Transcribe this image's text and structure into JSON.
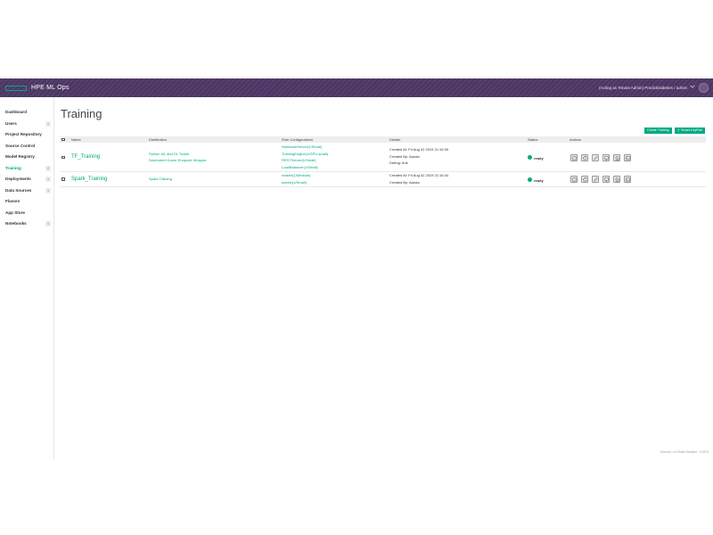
{
  "header": {
    "brand": "HPE ML Ops",
    "acting_as": "(Acting as Tenant Admin) PredictDiabetes / admin"
  },
  "sidebar": {
    "items": [
      {
        "label": "Dashboard",
        "badge": ""
      },
      {
        "label": "Users",
        "badge": "1"
      },
      {
        "label": "Project Repository",
        "badge": ""
      },
      {
        "label": "Source Control",
        "badge": ""
      },
      {
        "label": "Model Registry",
        "badge": ""
      },
      {
        "label": "Training",
        "badge": "2",
        "active": true
      },
      {
        "label": "Deployments",
        "badge": "1"
      },
      {
        "label": "Data Sources",
        "badge": "1"
      },
      {
        "label": "Flavors",
        "badge": ""
      },
      {
        "label": "App Store",
        "badge": ""
      },
      {
        "label": "Notebooks",
        "badge": "1"
      }
    ]
  },
  "page": {
    "title": "Training",
    "buttons": {
      "create": "Create Training",
      "keypair": "⚷ Tenant KeyPair"
    }
  },
  "table": {
    "columns": {
      "name": "Name",
      "distribution": "Distribution",
      "roles": "Role Configurations",
      "details": "Details",
      "status": "Status",
      "actions": "Actions"
    },
    "rows": [
      {
        "name": "TF_Training",
        "distribution": [
          "Python ML and DL Toolkit",
          "Dependent Donor Endpoint Wrapper"
        ],
        "roles": [
          "NotebookServer(1/Small)",
          "TrainingEngine(1/GPU-small)",
          "RESTServer(1/Small)",
          "LoadBalancer(1/Small)"
        ],
        "details": [
          "Created At: Fri Aug 02 2019 21:15:39",
          "Created By: Aanda",
          "Debug: true"
        ],
        "status": "ready"
      },
      {
        "name": "Spark_Training",
        "distribution": [
          "Spark Training"
        ],
        "roles": [
          "master(1/Medium)",
          "worker(1/Small)"
        ],
        "details": [
          "Created At: Fri Aug 02 2019 21:16:34",
          "Created By: Aanda"
        ],
        "status": "ready"
      }
    ]
  },
  "footer": {
    "version": "Version: v.0 Build Number : 21913"
  },
  "colors": {
    "accent": "#01a982",
    "header": "#4a3560"
  },
  "icons": [
    "stop-icon",
    "refresh-icon",
    "edit-icon",
    "monitor-icon",
    "notes-icon",
    "terminal-icon"
  ]
}
